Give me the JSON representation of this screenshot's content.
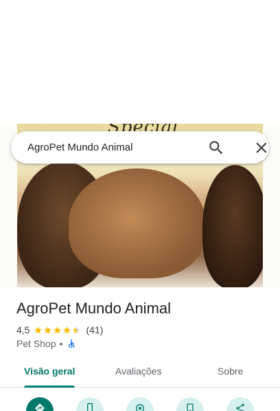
{
  "search": {
    "query": "AgroPet Mundo Animal"
  },
  "photo": {
    "bag_text": "Special"
  },
  "place": {
    "name": "AgroPet Mundo Animal",
    "rating": "4,5",
    "rating_fraction": 0.9,
    "review_count": "(41)",
    "category": "Pet Shop",
    "separator": "•",
    "accessibility_icon": "wheelchair-icon"
  },
  "tabs": [
    {
      "label": "Visão geral",
      "active": true
    },
    {
      "label": "Avaliações",
      "active": false
    },
    {
      "label": "Sobre",
      "active": false
    }
  ],
  "actions": [
    {
      "icon": "directions-icon"
    },
    {
      "icon": "phone-icon"
    },
    {
      "icon": "start-navigation-icon"
    },
    {
      "icon": "save-icon"
    },
    {
      "icon": "share-icon"
    }
  ],
  "colors": {
    "accent": "#00796b",
    "star": "#fbbc04",
    "action_bg": "#d6f0ee",
    "accessible": "#1a73e8"
  }
}
